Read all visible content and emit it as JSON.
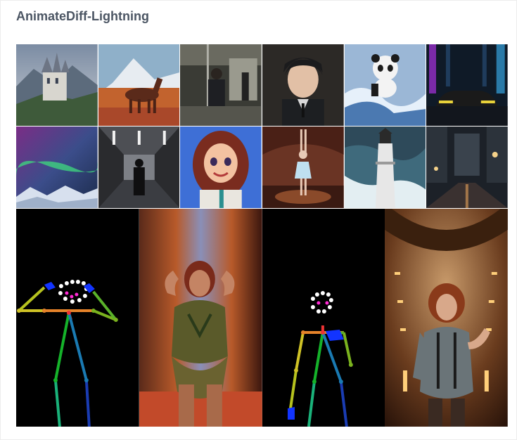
{
  "header": {
    "title": "AnimateDiff-Lightning"
  },
  "gallery": {
    "thumbnails": [
      {
        "subject": "castle-on-mountain"
      },
      {
        "subject": "horse-in-meadow"
      },
      {
        "subject": "man-on-subway"
      },
      {
        "subject": "anime-man-portrait"
      },
      {
        "subject": "panda-surfing"
      },
      {
        "subject": "sports-car-city"
      },
      {
        "subject": "aurora-over-mountains"
      },
      {
        "subject": "man-walking-corridor"
      },
      {
        "subject": "smiling-cartoon-girl"
      },
      {
        "subject": "ballerina-on-stage"
      },
      {
        "subject": "lighthouse-waves"
      },
      {
        "subject": "rainy-night-street"
      }
    ],
    "pose_panels": [
      {
        "subject": "pose-skeleton-arms-up"
      },
      {
        "subject": "woman-hands-on-head"
      },
      {
        "subject": "pose-skeleton-standing"
      },
      {
        "subject": "woman-in-hallway"
      }
    ]
  },
  "colors": {
    "title": "#4b5563",
    "background": "#ffffff"
  }
}
